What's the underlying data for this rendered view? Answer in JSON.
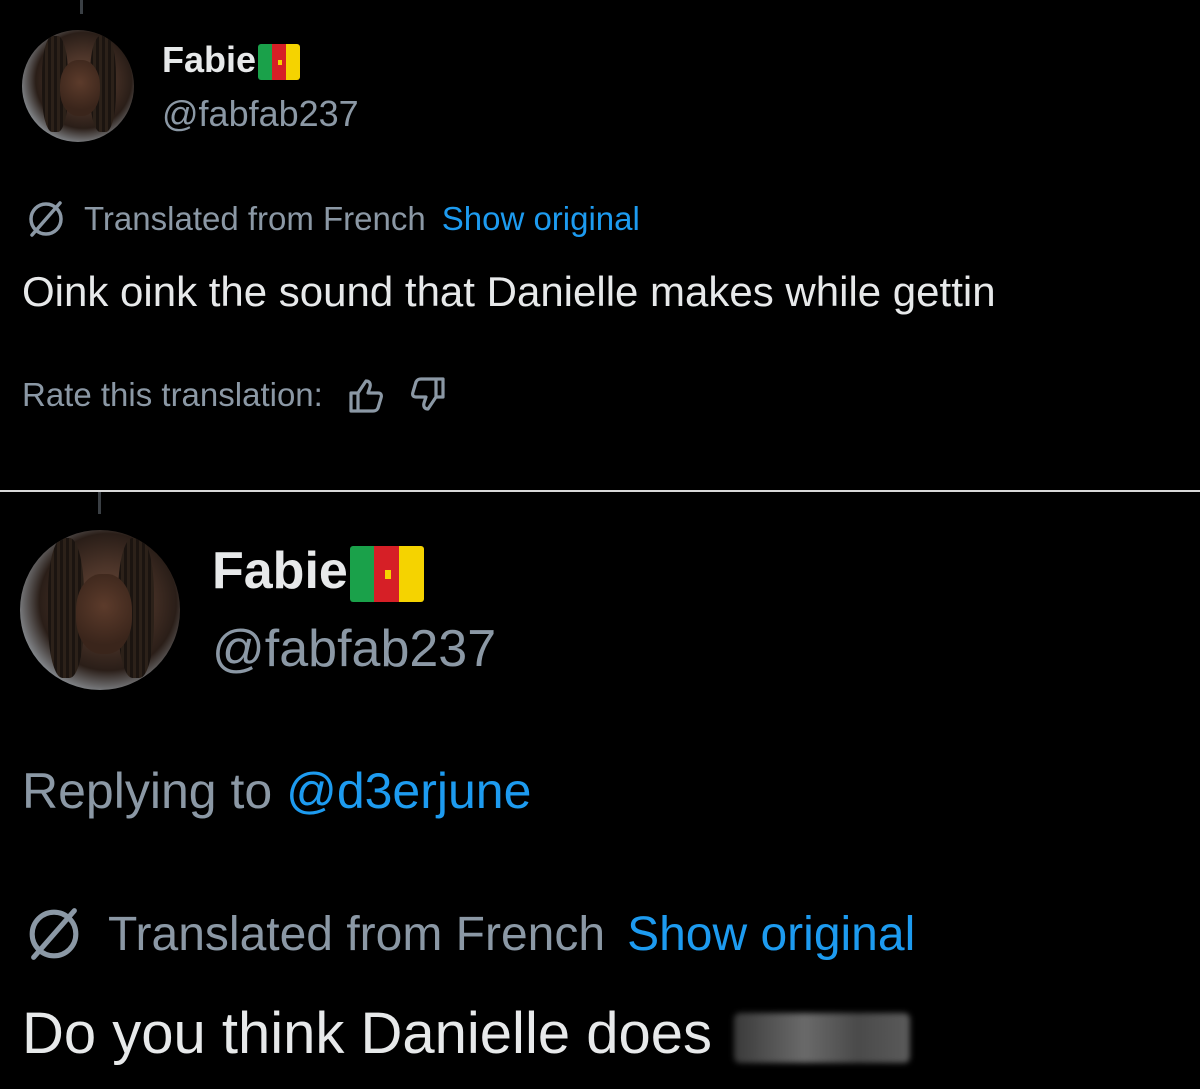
{
  "tweet_top": {
    "display_name": "Fabie",
    "flag_icon": "cameroon-flag-icon",
    "handle": "@fabfab237",
    "translated_label": "Translated from French",
    "show_original": "Show original",
    "text": "Oink oink the sound that Danielle makes while gettin",
    "rate_label": "Rate this translation:",
    "thumbs_up_icon": "thumbs-up-icon",
    "thumbs_down_icon": "thumbs-down-icon"
  },
  "tweet_bottom": {
    "display_name": "Fabie",
    "flag_icon": "cameroon-flag-icon",
    "handle": "@fabfab237",
    "replying_prefix": "Replying to",
    "replying_handle": "@d3erjune",
    "translated_label": "Translated from French",
    "show_original": "Show original",
    "text": "Do you think Danielle does"
  },
  "colors": {
    "background": "#000000",
    "text": "#e7e9ea",
    "secondary": "#8b98a5",
    "link": "#1d9bf0",
    "flag_green": "#1aa14a",
    "flag_red": "#d61f26",
    "flag_yellow": "#f5d300"
  }
}
